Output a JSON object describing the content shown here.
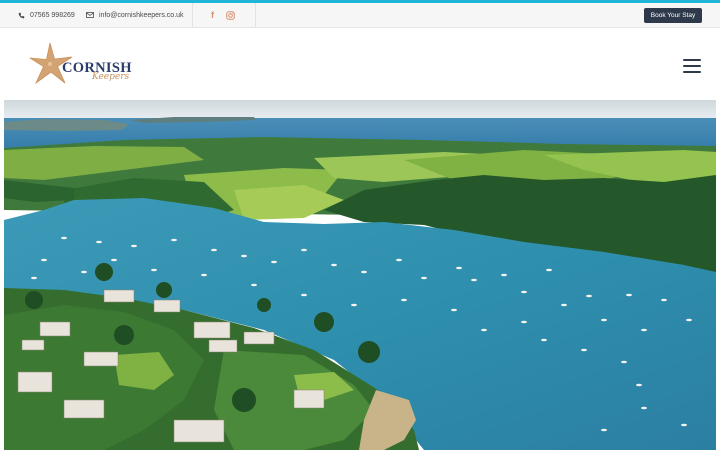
{
  "topbar": {
    "phone": "07565 998269",
    "email": "info@cornishkeepers.co.uk",
    "book_label": "Book Your Stay"
  },
  "logo": {
    "word": "CORNISH",
    "script": "Keepers"
  },
  "colors": {
    "accent": "#1fb6d8",
    "navy": "#2e3a4b",
    "gold": "#c8925b"
  },
  "icons": [
    "phone-icon",
    "envelope-icon",
    "facebook-icon",
    "instagram-icon",
    "hamburger-menu-icon",
    "starfish-icon"
  ]
}
